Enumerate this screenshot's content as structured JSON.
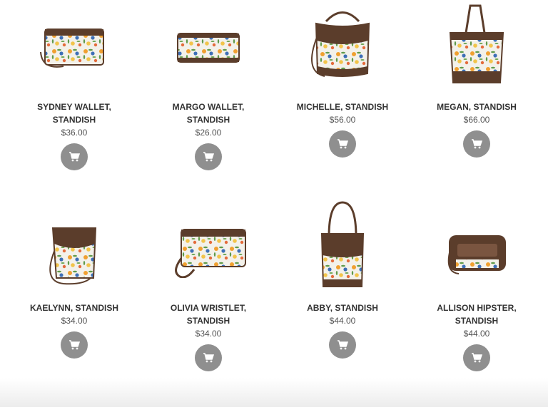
{
  "products": [
    {
      "name": "SYDNEY WALLET, STANDISH",
      "price": "$36.00",
      "image": "wallet-floral"
    },
    {
      "name": "MARGO WALLET, STANDISH",
      "price": "$26.00",
      "image": "wallet-floral"
    },
    {
      "name": "MICHELLE, STANDISH",
      "price": "$56.00",
      "image": "hobo-bag"
    },
    {
      "name": "MEGAN, STANDISH",
      "price": "$66.00",
      "image": "tote-bag"
    },
    {
      "name": "KAELYNN, STANDISH",
      "price": "$34.00",
      "image": "crossbody-bucket"
    },
    {
      "name": "OLIVIA WRISTLET, STANDISH",
      "price": "$34.00",
      "image": "wristlet"
    },
    {
      "name": "ABBY, STANDISH",
      "price": "$44.00",
      "image": "small-tote"
    },
    {
      "name": "ALLISON HIPSTER, STANDISH",
      "price": "$44.00",
      "image": "hipster-bag"
    }
  ],
  "cart_icon": "cart-icon",
  "colors": {
    "leather_brown": "#5b3d2b",
    "button_gray": "#8f8f8f",
    "floral_bg": "#f3f1ea",
    "flower_orange": "#f0a030",
    "flower_blue": "#3d6fb7",
    "flower_green": "#5f9a4a"
  }
}
